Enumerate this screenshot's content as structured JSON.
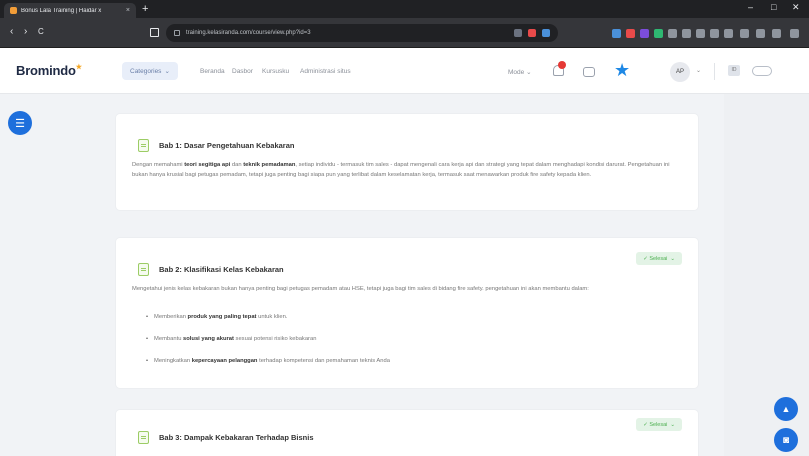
{
  "browser": {
    "tab_title": "Bonus Lala Training | Haidar x",
    "tab_close": "×",
    "new_tab": "+",
    "url": "training.kelasiranda.com/course/view.php?id=3",
    "win_min": "–",
    "win_max": "□",
    "win_close": "✕",
    "back": "‹",
    "forward": "›",
    "reload": "C"
  },
  "appbar": {
    "logo": "Bromindo",
    "menu": {
      "active": "Categories",
      "items": [
        "Beranda",
        "Dasbor",
        "Kursusku",
        "Administrasi situs"
      ]
    },
    "user_menu": "Mode",
    "avatar_initials": "AP",
    "lang_code": "ID"
  },
  "sections": [
    {
      "title": "Bab 1: Dasar Pengetahuan Kebakaran",
      "text": "Dengan memahami teori segitiga api dan teknik pemadaman, setiap individu - termasuk tim sales - dapat mengenali cara kerja api dan strategi yang tepat dalam menghadapi kondisi darurat. Pengetahuan ini bukan hanya krusial bagi petugas pemadam, tetapi juga penting bagi siapa pun yang terlibat dalam keselamatan kerja, termasuk saat menawarkan produk fire safety kepada klien."
    },
    {
      "title": "Bab 2: Klasifikasi Kelas Kebakaran",
      "badge": "✓ Selesai",
      "text": "Mengetahui jenis kelas kebakaran bukan hanya penting bagi petugas pemadam atau HSE, tetapi juga bagi tim sales di bidang fire safety. pengetahuan ini akan membantu dalam:",
      "bullets": [
        {
          "pre": "Memberikan ",
          "bold": "produk yang paling tepat",
          "post": " untuk klien."
        },
        {
          "pre": "Membantu ",
          "bold": "solusi yang akurat",
          "post": " sesuai potensi risiko kebakaran"
        },
        {
          "pre": "Meningkatkan ",
          "bold": "kepercayaan pelanggan",
          "post": " terhadap kompetensi dan pemahaman teknis Anda"
        }
      ]
    },
    {
      "title": "Bab 3: Dampak Kebakaran Terhadap Bisnis",
      "badge": "✓ Selesai"
    }
  ]
}
